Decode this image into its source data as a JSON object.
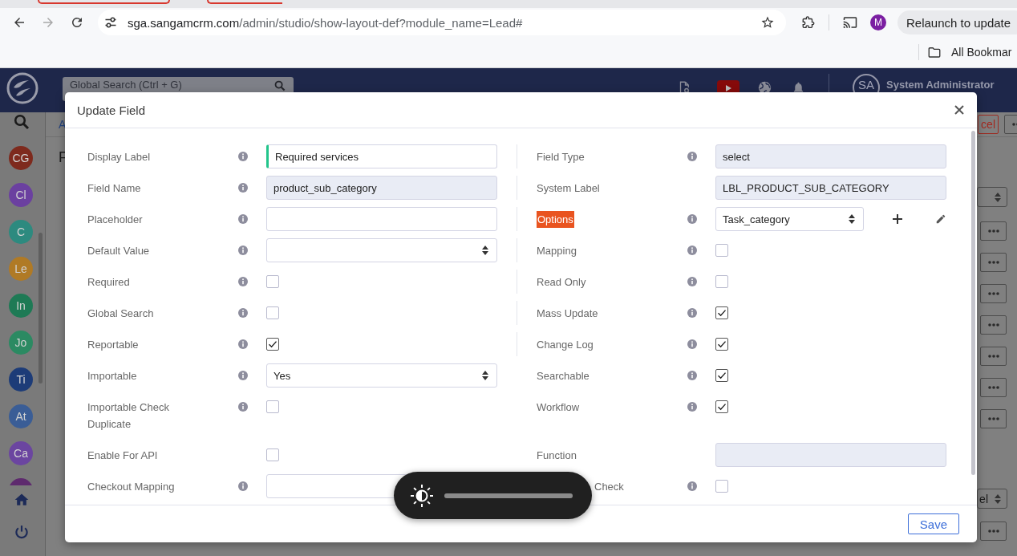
{
  "browser": {
    "url": {
      "host": "sga.sangamcrm.com",
      "path": "/admin/studio/show-layout-def?module_name=Lead#"
    },
    "profile_initial": "M",
    "relaunch_button": "Relaunch to update",
    "bookmarks_button": "All Bookmar"
  },
  "app_header": {
    "search_placeholder": "Global Search (Ctrl + G)",
    "user_initials": "SA",
    "user_name": "System Administrator"
  },
  "sidebar": {
    "items": [
      {
        "initials": "CG",
        "color": "#7e2a1d"
      },
      {
        "initials": "Cl",
        "color": "#6b40a0"
      },
      {
        "initials": "C",
        "color": "#2d8a7f"
      },
      {
        "initials": "Le",
        "color": "#b07a25"
      },
      {
        "initials": "In",
        "color": "#1e7a55"
      },
      {
        "initials": "Jo",
        "color": "#2b8a62"
      },
      {
        "initials": "Ti",
        "color": "#1d3c78"
      },
      {
        "initials": "At",
        "color": "#3a5d96"
      },
      {
        "initials": "Ca",
        "color": "#6b45a0"
      },
      {
        "color": "#5e2a6e"
      }
    ]
  },
  "page_behind": {
    "toolbar_link": "A",
    "cancel_button": "cel",
    "section_title": "F",
    "select_value": "el"
  },
  "dialog": {
    "title": "Update Field",
    "left_fields": [
      {
        "label": "Display Label",
        "info": true,
        "kind": "text",
        "value": "Required services",
        "focused": true,
        "highlighted": false,
        "obscured": false
      },
      {
        "label": "Field Name",
        "info": true,
        "kind": "readonly",
        "value": "product_sub_category",
        "highlighted": false,
        "obscured": false
      },
      {
        "label": "Placeholder",
        "info": true,
        "kind": "text",
        "focused": false,
        "highlighted": false,
        "obscured": false
      },
      {
        "label": "Default Value",
        "info": true,
        "kind": "select",
        "highlighted": false,
        "obscured": false
      },
      {
        "label": "Required",
        "info": true,
        "kind": "checkbox",
        "checked": false,
        "highlighted": false,
        "obscured": false
      },
      {
        "label": "Global Search",
        "info": true,
        "kind": "checkbox",
        "checked": false,
        "highlighted": false,
        "obscured": false
      },
      {
        "label": "Reportable",
        "info": true,
        "kind": "checkbox",
        "checked": true,
        "highlighted": false,
        "obscured": false
      },
      {
        "label": "Importable",
        "info": true,
        "kind": "select",
        "value": "Yes",
        "highlighted": false,
        "obscured": false
      },
      {
        "label": "Importable Check Duplicate",
        "info": true,
        "kind": "checkbox",
        "checked": false,
        "highlighted": false,
        "obscured": false
      },
      {
        "label": "Enable For API",
        "info": false,
        "kind": "checkbox",
        "checked": false,
        "highlighted": false,
        "obscured": false
      },
      {
        "label": "Checkout Mapping",
        "info": true,
        "kind": "text",
        "focused": false,
        "highlighted": false,
        "obscured": false
      }
    ],
    "right_fields": [
      {
        "label": "Field Type",
        "info": true,
        "kind": "readonly",
        "value": "select",
        "highlighted": false,
        "obscured": false
      },
      {
        "label": "System Label",
        "info": false,
        "kind": "readonly",
        "value": "LBL_PRODUCT_SUB_CATEGORY",
        "highlighted": false,
        "obscured": false
      },
      {
        "label": "Options",
        "info": true,
        "kind": "options",
        "value": "Task_category",
        "highlighted": true,
        "obscured": false
      },
      {
        "label": "Mapping",
        "info": true,
        "kind": "checkbox",
        "checked": false,
        "highlighted": false,
        "obscured": false
      },
      {
        "label": "Read Only",
        "info": true,
        "kind": "checkbox",
        "checked": false,
        "highlighted": false,
        "obscured": false
      },
      {
        "label": "Mass Update",
        "info": true,
        "kind": "checkbox",
        "checked": true,
        "highlighted": false,
        "obscured": false
      },
      {
        "label": "Change Log",
        "info": true,
        "kind": "checkbox",
        "checked": true,
        "highlighted": false,
        "obscured": false
      },
      {
        "label": "Searchable",
        "info": true,
        "kind": "checkbox",
        "checked": true,
        "highlighted": false,
        "obscured": false
      },
      {
        "label": "Workflow",
        "info": true,
        "kind": "checkbox",
        "checked": true,
        "highlighted": false,
        "obscured": false
      },
      {
        "label": "Function",
        "info": false,
        "kind": "readonly",
        "highlighted": false,
        "obscured": false
      },
      {
        "label": "Check",
        "info": true,
        "kind": "checkbox",
        "checked": false,
        "highlighted": false,
        "obscured": true
      }
    ],
    "save_button": "Save"
  },
  "brightness_popup": {
    "level": 1
  }
}
